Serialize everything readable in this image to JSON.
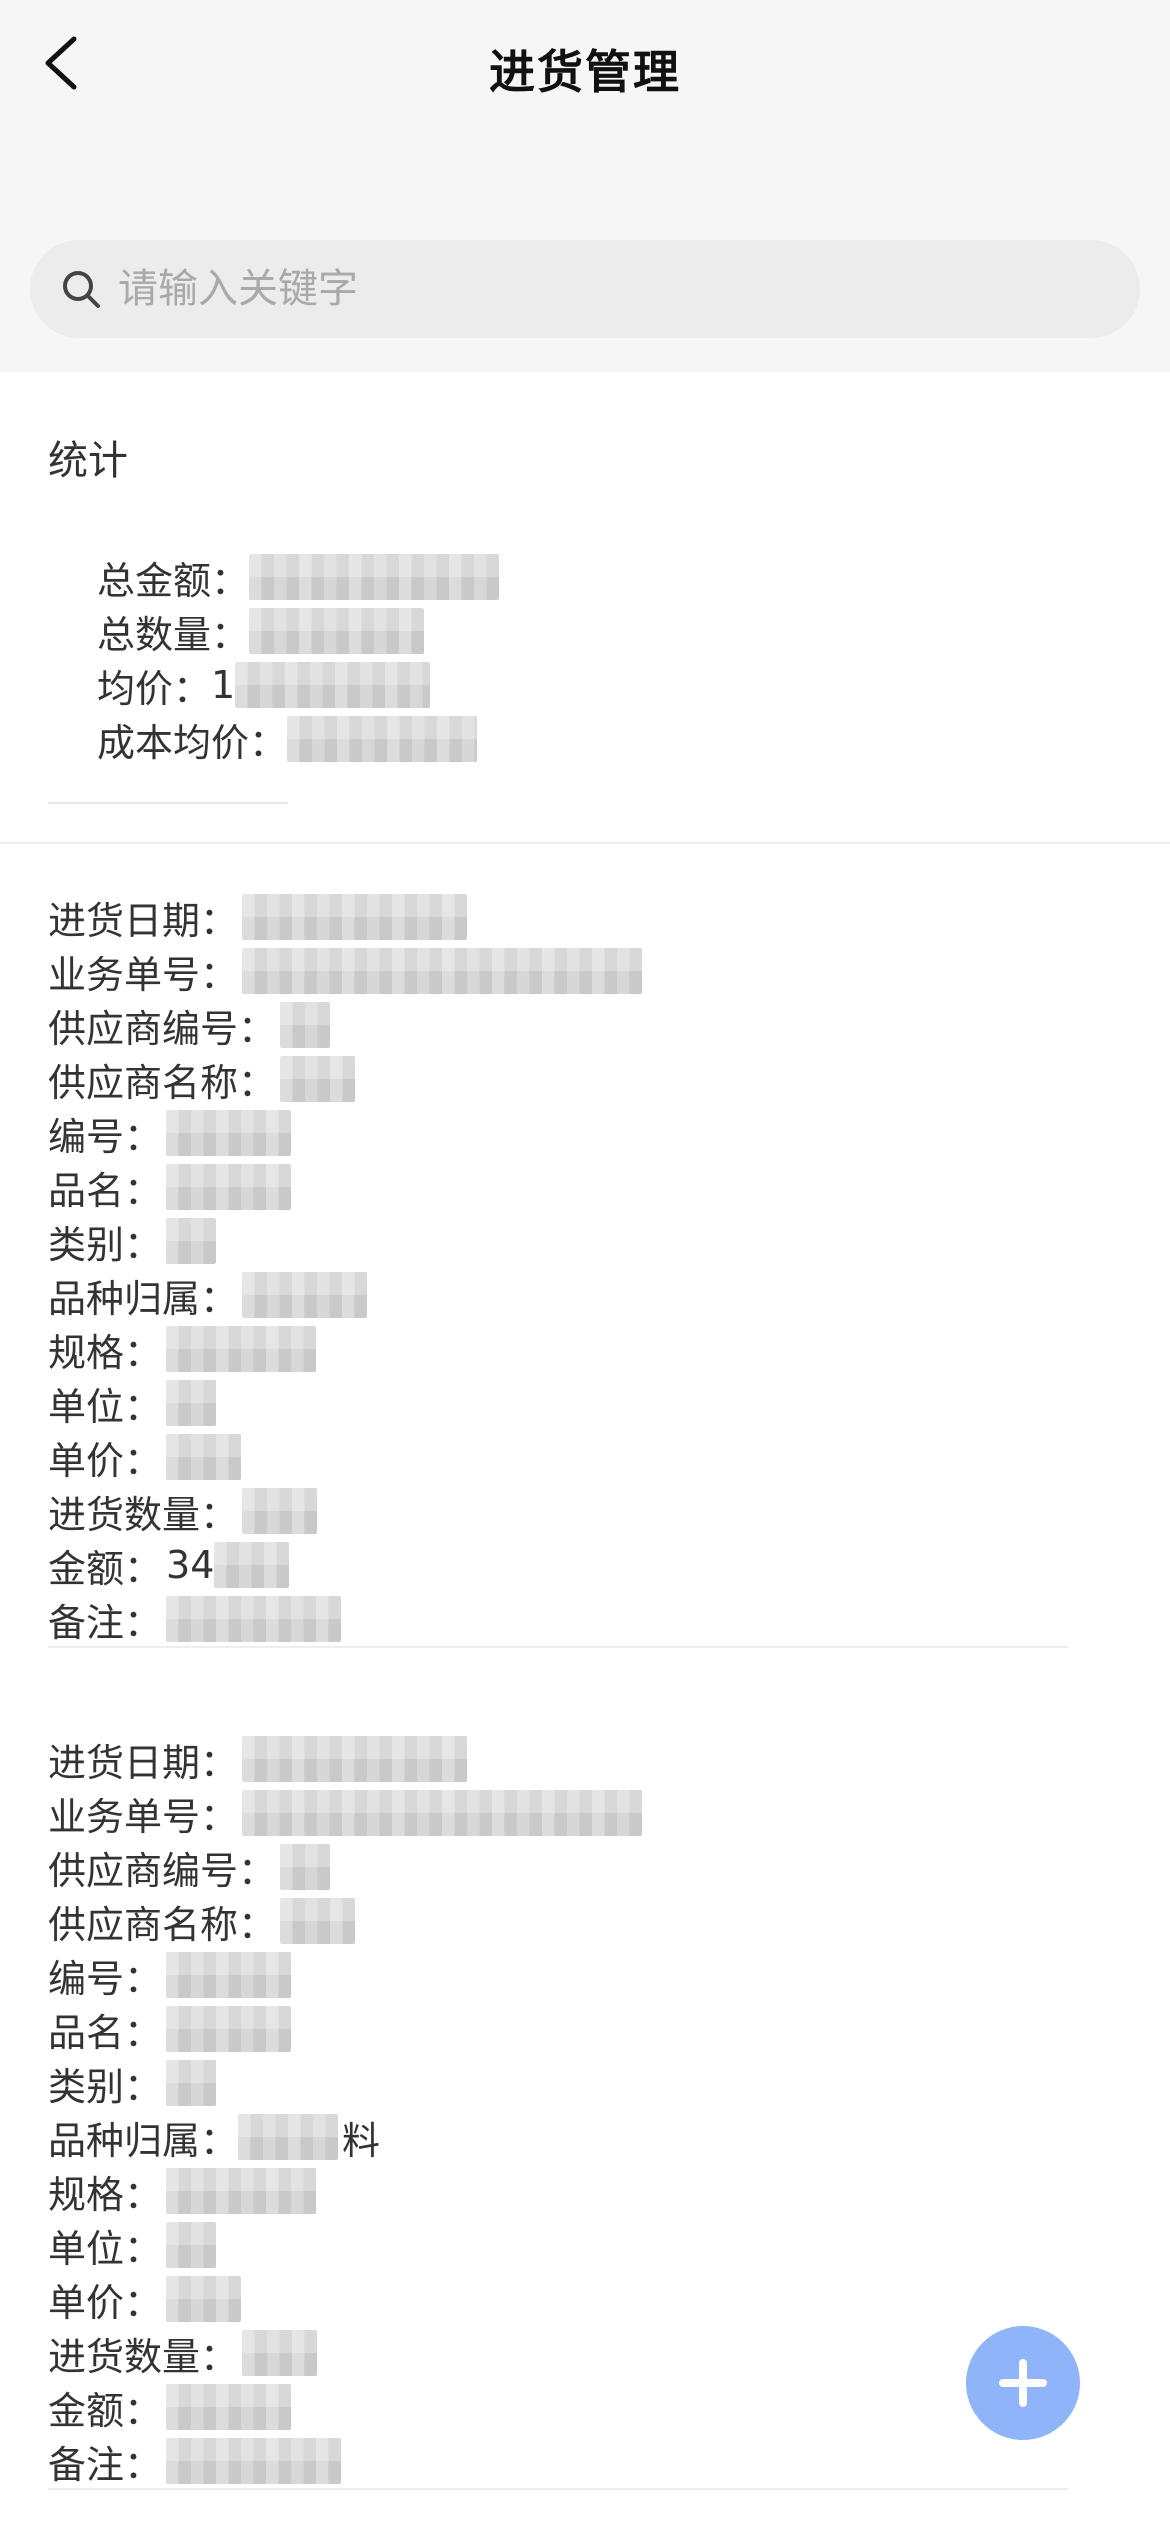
{
  "header": {
    "title": "进货管理",
    "back_icon": "chevron-left-icon"
  },
  "search": {
    "placeholder": "请输入关键字",
    "icon": "search-icon"
  },
  "stats": {
    "title": "统计",
    "rows": [
      {
        "label": "总金额：",
        "value": ""
      },
      {
        "label": "总数量：",
        "value": ""
      },
      {
        "label": "均价：",
        "value": "1"
      },
      {
        "label": "成本均价：",
        "value": ""
      }
    ]
  },
  "records": [
    {
      "fields": [
        {
          "label": "进货日期：",
          "value": ""
        },
        {
          "label": "业务单号：",
          "value": ""
        },
        {
          "label": "供应商编号：",
          "value": ""
        },
        {
          "label": "供应商名称：",
          "value": ""
        },
        {
          "label": "编号：",
          "value": ""
        },
        {
          "label": "品名：",
          "value": ""
        },
        {
          "label": "类别：",
          "value": ""
        },
        {
          "label": "品种归属：",
          "value": ""
        },
        {
          "label": "规格：",
          "value": ""
        },
        {
          "label": "单位：",
          "value": ""
        },
        {
          "label": "单价：",
          "value": ""
        },
        {
          "label": "进货数量：",
          "value": ""
        },
        {
          "label": "金额：",
          "value": "34"
        },
        {
          "label": "备注：",
          "value": ""
        }
      ]
    },
    {
      "fields": [
        {
          "label": "进货日期：",
          "value": ""
        },
        {
          "label": "业务单号：",
          "value": ""
        },
        {
          "label": "供应商编号：",
          "value": ""
        },
        {
          "label": "供应商名称：",
          "value": ""
        },
        {
          "label": "编号：",
          "value": ""
        },
        {
          "label": "品名：",
          "value": ""
        },
        {
          "label": "类别：",
          "value": ""
        },
        {
          "label": "品种归属：",
          "value": "料"
        },
        {
          "label": "规格：",
          "value": ""
        },
        {
          "label": "单位：",
          "value": ""
        },
        {
          "label": "单价：",
          "value": ""
        },
        {
          "label": "进货数量：",
          "value": ""
        },
        {
          "label": "金额：",
          "value": ""
        },
        {
          "label": "备注：",
          "value": ""
        }
      ]
    }
  ],
  "fab": {
    "icon": "plus-icon",
    "color": "#8fb4f9"
  },
  "colors": {
    "background_top": "#f6f6f6",
    "search_bg": "#ececec",
    "text": "#333333",
    "placeholder": "#a9a9a9"
  }
}
